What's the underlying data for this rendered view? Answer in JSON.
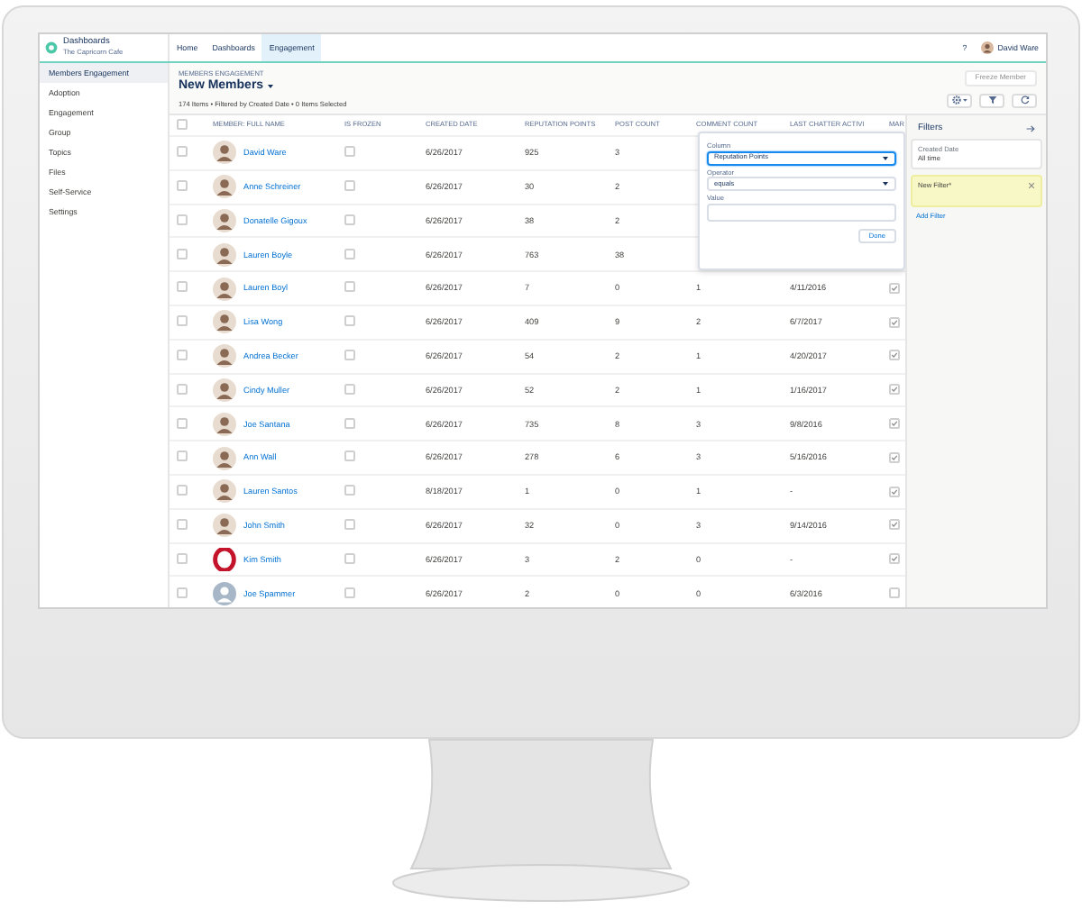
{
  "header": {
    "app_title": "Dashboards",
    "app_subtitle": "The Capricorn Cafe",
    "tabs": [
      {
        "label": "Home",
        "selected": false
      },
      {
        "label": "Dashboards",
        "selected": false
      },
      {
        "label": "Engagement",
        "selected": true
      }
    ],
    "help": "?",
    "user": "David Ware"
  },
  "sidebar": {
    "items": [
      {
        "label": "Members Engagement",
        "selected": true
      },
      {
        "label": "Adoption",
        "selected": false
      },
      {
        "label": "Engagement",
        "selected": false
      },
      {
        "label": "Group",
        "selected": false
      },
      {
        "label": "Topics",
        "selected": false
      },
      {
        "label": "Files",
        "selected": false
      },
      {
        "label": "Self-Service",
        "selected": false
      },
      {
        "label": "Settings",
        "selected": false
      }
    ]
  },
  "page": {
    "eyebrow": "MEMBERS ENGAGEMENT",
    "title": "New Members",
    "summary": "174 Items • Filtered by Created Date • 0 Items Selected",
    "freeze_button": {
      "label": "Freeze Member",
      "disabled": true
    }
  },
  "table": {
    "select_all_checked": false,
    "columns": [
      "MEMBER: FULL NAME",
      "IS FROZEN",
      "CREATED DATE",
      "REPUTATION POINTS",
      "POST COUNT",
      "COMMENT COUNT",
      "LAST CHATTER ACTIVI",
      "MAR"
    ],
    "rows": [
      {
        "name": "David Ware",
        "avatar": {
          "kind": "photo"
        },
        "selected": false,
        "frozen": false,
        "created": "6/26/2017",
        "reputation": "925",
        "posts": "3"
      },
      {
        "name": "Anne Schreiner",
        "avatar": {
          "kind": "photo"
        },
        "selected": false,
        "frozen": false,
        "created": "6/26/2017",
        "reputation": "30",
        "posts": "2"
      },
      {
        "name": "Donatelle Gigoux",
        "avatar": {
          "kind": "photo"
        },
        "selected": false,
        "frozen": false,
        "created": "6/26/2017",
        "reputation": "38",
        "posts": "2"
      },
      {
        "name": "Lauren Boyle",
        "avatar": {
          "kind": "photo"
        },
        "selected": false,
        "frozen": false,
        "created": "6/26/2017",
        "reputation": "763",
        "posts": "38"
      },
      {
        "name": "Lauren Boyl",
        "avatar": {
          "kind": "photo"
        },
        "selected": false,
        "frozen": false,
        "created": "6/26/2017",
        "reputation": "7",
        "posts": "0",
        "comments": "1",
        "last_activity": "4/11/2016",
        "flag_checked": true
      },
      {
        "name": "Lisa Wong",
        "avatar": {
          "kind": "photo"
        },
        "selected": false,
        "frozen": false,
        "created": "6/26/2017",
        "reputation": "409",
        "posts": "9",
        "comments": "2",
        "last_activity": "6/7/2017",
        "flag_checked": true
      },
      {
        "name": "Andrea Becker",
        "avatar": {
          "kind": "photo"
        },
        "selected": false,
        "frozen": false,
        "created": "6/26/2017",
        "reputation": "54",
        "posts": "2",
        "comments": "1",
        "last_activity": "4/20/2017",
        "flag_checked": true
      },
      {
        "name": "Cindy Muller",
        "avatar": {
          "kind": "photo"
        },
        "selected": false,
        "frozen": false,
        "created": "6/26/2017",
        "reputation": "52",
        "posts": "2",
        "comments": "1",
        "last_activity": "1/16/2017",
        "flag_checked": true
      },
      {
        "name": "Joe Santana",
        "avatar": {
          "kind": "photo"
        },
        "selected": false,
        "frozen": false,
        "created": "6/26/2017",
        "reputation": "735",
        "posts": "8",
        "comments": "3",
        "last_activity": "9/8/2016",
        "flag_checked": true
      },
      {
        "name": "Ann Wall",
        "avatar": {
          "kind": "photo"
        },
        "selected": false,
        "frozen": false,
        "created": "6/26/2017",
        "reputation": "278",
        "posts": "6",
        "comments": "3",
        "last_activity": "5/16/2016",
        "flag_checked": true
      },
      {
        "name": "Lauren Santos",
        "avatar": {
          "kind": "photo"
        },
        "selected": false,
        "frozen": false,
        "created": "8/18/2017",
        "reputation": "1",
        "posts": "0",
        "comments": "1",
        "last_activity": "-",
        "flag_checked": true
      },
      {
        "name": "John Smith",
        "avatar": {
          "kind": "photo"
        },
        "selected": false,
        "frozen": false,
        "created": "6/26/2017",
        "reputation": "32",
        "posts": "0",
        "comments": "3",
        "last_activity": "9/14/2016",
        "flag_checked": true
      },
      {
        "name": "Kim Smith",
        "avatar": {
          "kind": "logo"
        },
        "selected": false,
        "frozen": false,
        "created": "6/26/2017",
        "reputation": "3",
        "posts": "2",
        "comments": "0",
        "last_activity": "-",
        "flag_checked": true
      },
      {
        "name": "Joe Spammer",
        "avatar": {
          "kind": "default"
        },
        "selected": false,
        "frozen": false,
        "created": "6/26/2017",
        "reputation": "2",
        "posts": "0",
        "comments": "0",
        "last_activity": "6/3/2016",
        "flag_checked": false
      }
    ]
  },
  "popover": {
    "fields": [
      {
        "label": "Column",
        "kind": "select",
        "value": "Reputation Points",
        "focused": true
      },
      {
        "label": "Operator",
        "kind": "select",
        "value": "equals",
        "focused": false
      },
      {
        "label": "Value",
        "kind": "input"
      }
    ],
    "done": "Done"
  },
  "filters": {
    "title": "Filters",
    "cards": [
      {
        "kind": "applied",
        "label": "Created Date",
        "value": "All time"
      },
      {
        "kind": "new",
        "label": "New Filter*"
      }
    ],
    "add": "Add Filter"
  }
}
